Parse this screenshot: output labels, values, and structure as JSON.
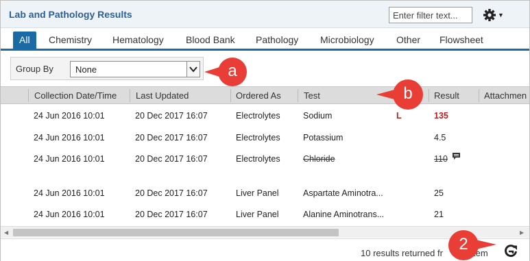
{
  "header": {
    "title": "Lab and Pathology Results",
    "filter_placeholder": "Enter filter text..."
  },
  "tabs": [
    {
      "label": "All",
      "active": true
    },
    {
      "label": "Chemistry"
    },
    {
      "label": "Hematology"
    },
    {
      "label": "Blood Bank"
    },
    {
      "label": "Pathology"
    },
    {
      "label": "Microbiology"
    },
    {
      "label": "Other"
    },
    {
      "label": "Flowsheet"
    }
  ],
  "group_by": {
    "label": "Group By",
    "value": "None"
  },
  "table": {
    "columns": [
      "Collection Date/Time",
      "Last Updated",
      "Ordered As",
      "Test",
      "Result",
      "Attachmen"
    ],
    "rows": [
      {
        "collection": "24 Jun 2016 10:01",
        "updated": "20 Dec 2017 16:07",
        "ordered_as": "Electrolytes",
        "test": "Sodium",
        "flag": "L",
        "result": "135"
      },
      {
        "collection": "24 Jun 2016 10:01",
        "updated": "20 Dec 2017 16:07",
        "ordered_as": "Electrolytes",
        "test": "Potassium",
        "flag": "",
        "result": "4.5"
      },
      {
        "collection": "24 Jun 2016 10:01",
        "updated": "20 Dec 2017 16:07",
        "ordered_as": "Electrolytes",
        "test": "Chloride",
        "flag": "",
        "result": "110"
      },
      {
        "collection": "24 Jun 2016 10:01",
        "updated": "20 Dec 2017 16:07",
        "ordered_as": "Liver Panel",
        "test": "Aspartate Aminotra...",
        "flag": "",
        "result": "25"
      },
      {
        "collection": "24 Jun 2016 10:01",
        "updated": "20 Dec 2017 16:07",
        "ordered_as": "Liver Panel",
        "test": "Alanine Aminotrans...",
        "flag": "",
        "result": "21"
      }
    ]
  },
  "footer": {
    "status_text": "10 results returned fr",
    "status_tail": "tem"
  },
  "callouts": {
    "a": "a",
    "b": "b",
    "two": "2"
  },
  "colors": {
    "title": "#2b5f96",
    "tab_active": "#1a6aa5",
    "abnormal": "#b51c1c",
    "callout": "#e93e36"
  },
  "icons": {
    "settings": "gear-icon",
    "refresh": "refresh-icon",
    "comment": "comment-icon",
    "dropdown": "chevron-down-icon"
  }
}
